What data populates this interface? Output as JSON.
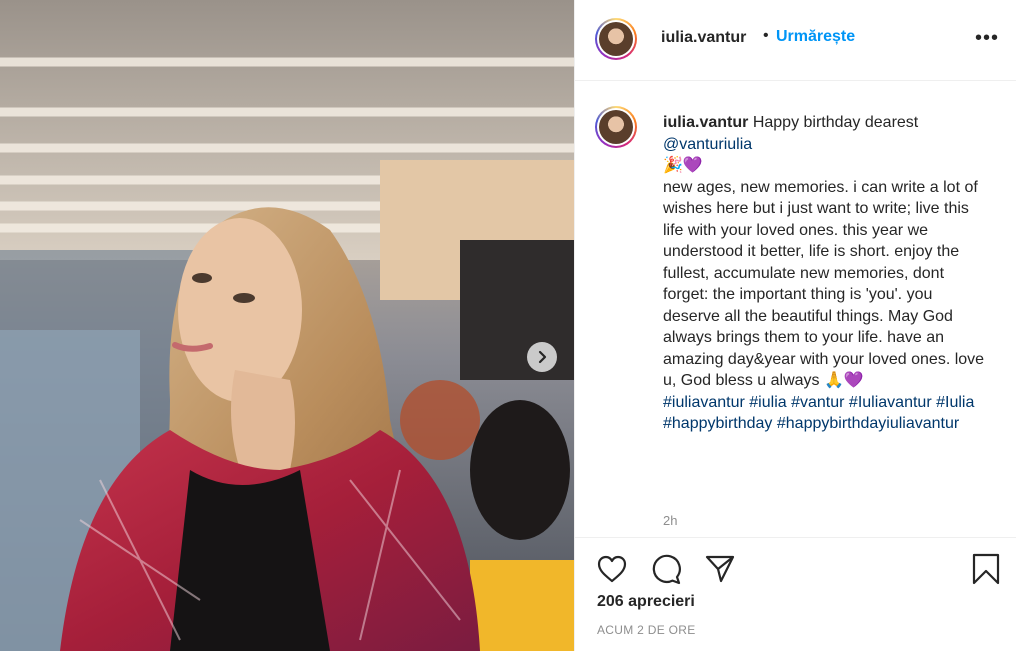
{
  "post": {
    "username": "iulia.vantur",
    "separator": "•",
    "follow_label": "Urmărește",
    "more_label": "•••"
  },
  "caption": {
    "username": "iulia.vantur",
    "intro": "Happy birthday dearest",
    "mention": "@vanturiulia",
    "emoji_line": "🎉💜",
    "body": "new ages, new memories. i can write a lot of wishes here but i just want to write; live this life with your loved ones. this year we understood it better, life is short. enjoy the fullest, accumulate new memories, dont forget: the important thing is 'you'. you deserve all the beautiful things. May God always brings them to your life. have an amazing day&year with your loved ones. love u, God bless u always",
    "body_emoji": "🙏💜",
    "hashtags": [
      "#iuliavantur",
      "#iulia",
      "#vantur",
      "#Iuliavantur",
      "#Iulia",
      "#happybirthday",
      "#happybirthdayiuliavantur"
    ],
    "time": "2h"
  },
  "footer": {
    "likes": "206 aprecieri",
    "ago": "ACUM 2 DE ORE"
  },
  "icons": {
    "like": "heart-icon",
    "comment": "comment-icon",
    "share": "share-icon",
    "save": "bookmark-icon",
    "next": "chevron-right-icon"
  }
}
